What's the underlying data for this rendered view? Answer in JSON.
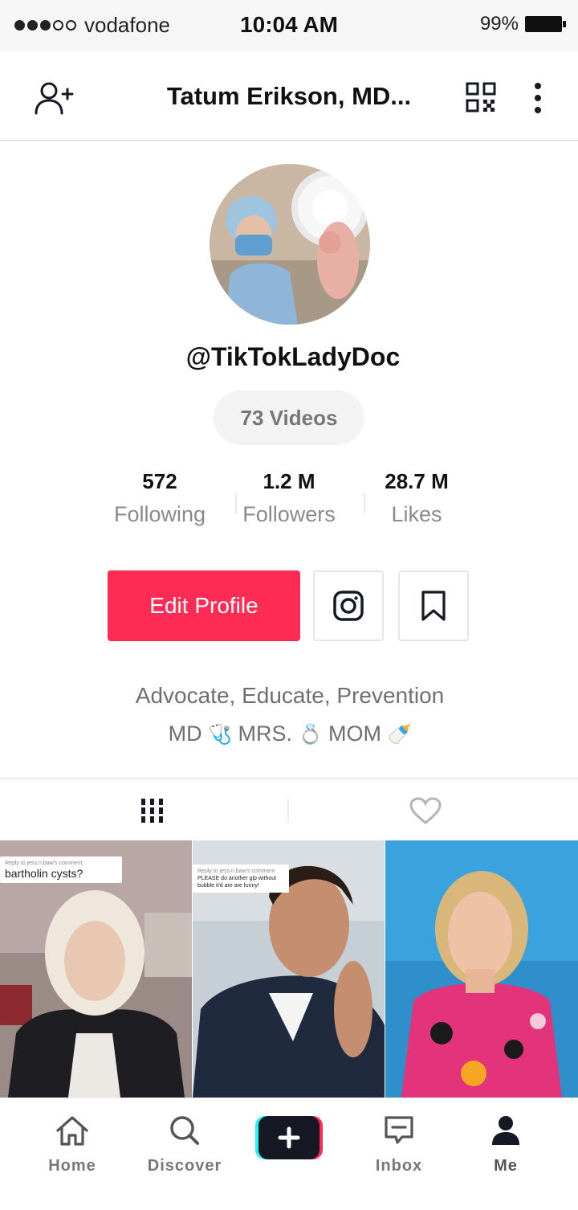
{
  "status_bar": {
    "carrier": "vodafone",
    "time": "10:04 AM",
    "battery": "99%"
  },
  "header": {
    "title": "Tatum Erikson, MD..."
  },
  "profile": {
    "username": "@TikTokLadyDoc",
    "videos_label": "73 Videos",
    "stats": [
      {
        "value": "572",
        "label": "Following"
      },
      {
        "value": "1.2 M",
        "label": "Followers"
      },
      {
        "value": "28.7 M",
        "label": "Likes"
      }
    ],
    "edit_button": "Edit Profile",
    "bio_line1": "Advocate, Educate, Prevention",
    "bio_line2_parts": [
      "MD",
      "🩺",
      "MRS.",
      "💍",
      "MOM",
      "🍼"
    ]
  },
  "videos": [
    {
      "caption_top": "Reply to jess.n.baw's comment",
      "caption": "bartholin cysts?"
    },
    {
      "caption_top": "Reply to jess.n.baw's comment",
      "caption": "PLEASE do another glp without bubble it'd are are funny!"
    },
    {
      "caption_top": "",
      "caption": ""
    }
  ],
  "nav": {
    "home": "Home",
    "discover": "Discover",
    "inbox": "Inbox",
    "me": "Me"
  },
  "colors": {
    "accent": "#fe2c55",
    "plus_cyan": "#25f4ee",
    "plus_red": "#fe2c55"
  },
  "icons": [
    "add-user-icon",
    "qr-code-icon",
    "more-vertical-icon",
    "instagram-icon",
    "bookmark-icon",
    "grid-icon",
    "heart-icon",
    "home-icon",
    "search-icon",
    "plus-icon",
    "inbox-icon",
    "profile-icon"
  ]
}
